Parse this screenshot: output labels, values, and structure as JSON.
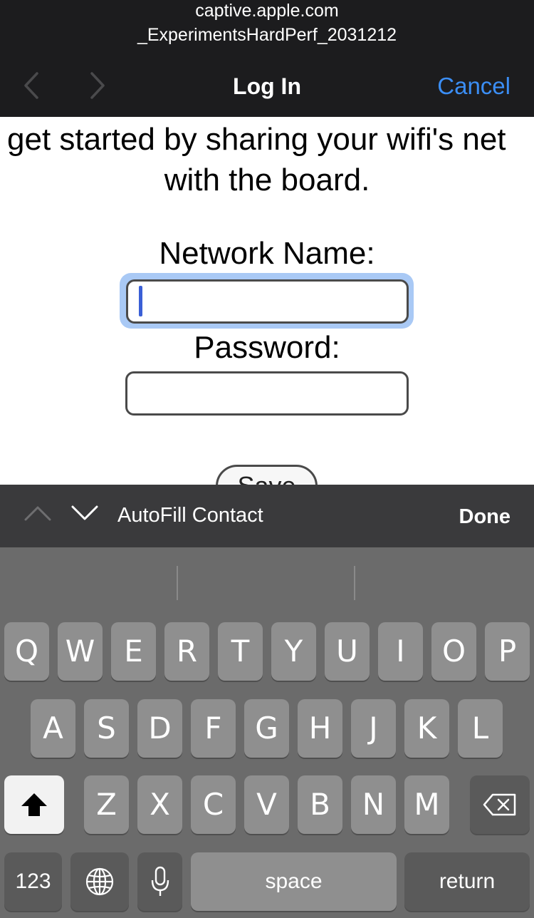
{
  "browser": {
    "domain": "captive.apple.com",
    "page_path": "_ExperimentsHardPerf_2031212",
    "title": "Log In",
    "cancel_label": "Cancel"
  },
  "page": {
    "intro_line1": "get started by sharing your wifi's net",
    "intro_line2": "with the board.",
    "network_label": "Network Name:",
    "network_value": "",
    "password_label": "Password:",
    "password_value": "",
    "save_label": "Save"
  },
  "accessory": {
    "autofill_label": "AutoFill Contact",
    "done_label": "Done"
  },
  "keyboard": {
    "row1": [
      "Q",
      "W",
      "E",
      "R",
      "T",
      "Y",
      "U",
      "I",
      "O",
      "P"
    ],
    "row2": [
      "A",
      "S",
      "D",
      "F",
      "G",
      "H",
      "J",
      "K",
      "L"
    ],
    "row3": [
      "Z",
      "X",
      "C",
      "V",
      "B",
      "N",
      "M"
    ],
    "numbers_label": "123",
    "space_label": "space",
    "return_label": "return",
    "icons": [
      "shift-icon",
      "delete-icon",
      "globe-icon",
      "microphone-icon"
    ]
  },
  "colors": {
    "accent": "#3b8ef5",
    "focus_ring": "#a9c9f5",
    "caret": "#3a5fd6"
  }
}
